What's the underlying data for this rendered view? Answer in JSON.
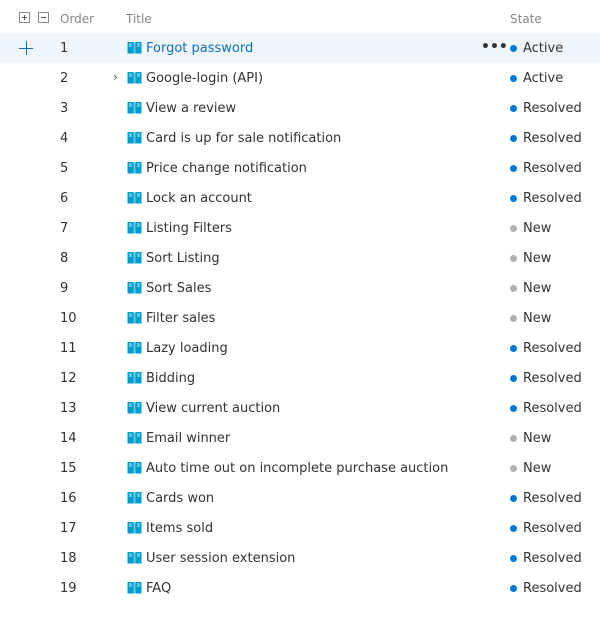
{
  "header": {
    "order_label": "Order",
    "title_label": "Title",
    "state_label": "State"
  },
  "colors": {
    "resolved": "#0078d4",
    "active": "#0078d4",
    "new": "#b1b1b1",
    "book_icon": "#009ccc",
    "selected_bg": "#eff6fc"
  },
  "rows": [
    {
      "order": "1",
      "title": "Forgot password",
      "state": "Active",
      "status": "active",
      "selected": true,
      "has_more": true,
      "expandable": false
    },
    {
      "order": "2",
      "title": "Google-login (API)",
      "state": "Active",
      "status": "active",
      "expandable": true
    },
    {
      "order": "3",
      "title": "View a review",
      "state": "Resolved",
      "status": "resolved"
    },
    {
      "order": "4",
      "title": "Card is up for sale notification",
      "state": "Resolved",
      "status": "resolved"
    },
    {
      "order": "5",
      "title": "Price change notification",
      "state": "Resolved",
      "status": "resolved"
    },
    {
      "order": "6",
      "title": "Lock an account",
      "state": "Resolved",
      "status": "resolved"
    },
    {
      "order": "7",
      "title": "Listing Filters",
      "state": "New",
      "status": "new"
    },
    {
      "order": "8",
      "title": "Sort Listing",
      "state": "New",
      "status": "new"
    },
    {
      "order": "9",
      "title": "Sort Sales",
      "state": "New",
      "status": "new"
    },
    {
      "order": "10",
      "title": "Filter sales",
      "state": "New",
      "status": "new"
    },
    {
      "order": "11",
      "title": "Lazy loading",
      "state": "Resolved",
      "status": "resolved"
    },
    {
      "order": "12",
      "title": "Bidding",
      "state": "Resolved",
      "status": "resolved"
    },
    {
      "order": "13",
      "title": "View current auction",
      "state": "Resolved",
      "status": "resolved"
    },
    {
      "order": "14",
      "title": "Email winner",
      "state": "New",
      "status": "new"
    },
    {
      "order": "15",
      "title": "Auto time out on incomplete purchase auction",
      "state": "New",
      "status": "new"
    },
    {
      "order": "16",
      "title": "Cards won",
      "state": "Resolved",
      "status": "resolved"
    },
    {
      "order": "17",
      "title": "Items sold",
      "state": "Resolved",
      "status": "resolved"
    },
    {
      "order": "18",
      "title": "User session extension",
      "state": "Resolved",
      "status": "resolved"
    },
    {
      "order": "19",
      "title": "FAQ",
      "state": "Resolved",
      "status": "resolved"
    }
  ]
}
